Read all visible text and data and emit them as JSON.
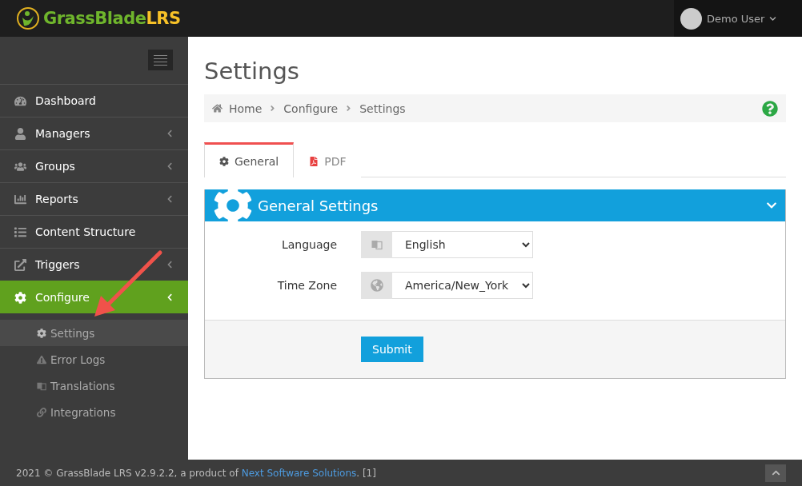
{
  "header": {
    "logo": {
      "name": "GrassBlade",
      "suffix": "LRS"
    },
    "user": "Demo User"
  },
  "sidebar": {
    "items": [
      {
        "label": "Dashboard",
        "submenu": false,
        "selected": false
      },
      {
        "label": "Managers",
        "submenu": true,
        "selected": false
      },
      {
        "label": "Groups",
        "submenu": true,
        "selected": false
      },
      {
        "label": "Reports",
        "submenu": true,
        "selected": false
      },
      {
        "label": "Content Structure",
        "submenu": false,
        "selected": false
      },
      {
        "label": "Triggers",
        "submenu": true,
        "selected": false
      },
      {
        "label": "Configure",
        "submenu": true,
        "selected": true,
        "children": [
          {
            "label": "Settings",
            "selected": true
          },
          {
            "label": "Error Logs",
            "selected": false
          },
          {
            "label": "Translations",
            "selected": false
          },
          {
            "label": "Integrations",
            "selected": false
          }
        ]
      }
    ]
  },
  "page": {
    "title": "Settings",
    "breadcrumb": [
      "Home",
      "Configure",
      "Settings"
    ]
  },
  "tabs": [
    {
      "label": "General",
      "selected": true
    },
    {
      "label": "PDF",
      "selected": false
    }
  ],
  "panel": {
    "title": "General Settings",
    "expanded": true,
    "fields": [
      {
        "label": "Language",
        "value": "English"
      },
      {
        "label": "Time Zone",
        "value": "America/New_York"
      }
    ],
    "submit": "Submit"
  },
  "footer": {
    "text": "2021 © GrassBlade LRS v2.9.2.2, a product of ",
    "link": "Next Software Solutions",
    "suffix": ". [1]"
  }
}
